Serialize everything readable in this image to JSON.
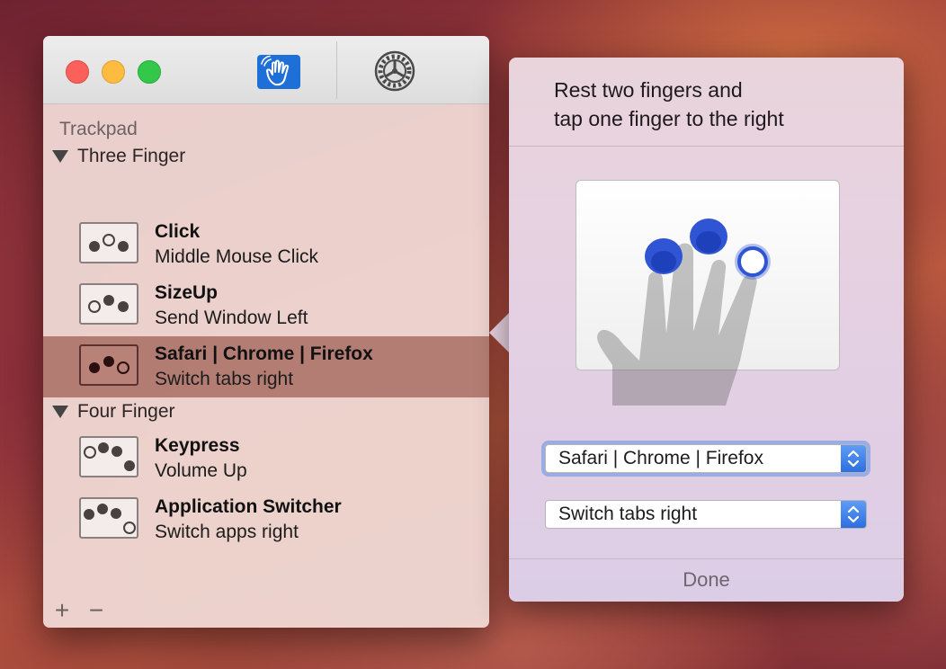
{
  "window": {
    "toolbar": {
      "gesture_tab_icon": "hand-gesture-icon",
      "settings_tab_icon": "gear-icon"
    },
    "section_title": "Trackpad",
    "groups": [
      {
        "label": "Three Finger",
        "rows": [
          {
            "title": "Click",
            "subtitle": "Middle Mouse Click",
            "icon": "three-finger-middle-tap-icon"
          },
          {
            "title": "SizeUp",
            "subtitle": "Send Window Left",
            "icon": "three-finger-left-tap-icon"
          },
          {
            "title": "Safari | Chrome | Firefox",
            "subtitle": "Switch tabs right",
            "icon": "three-finger-right-tap-icon",
            "selected": true
          }
        ]
      },
      {
        "label": "Four Finger",
        "rows": [
          {
            "title": "Keypress",
            "subtitle": "Volume Up",
            "icon": "four-finger-left-tap-icon"
          },
          {
            "title": "Application Switcher",
            "subtitle": "Switch apps right",
            "icon": "four-finger-right-tap-icon"
          }
        ]
      }
    ],
    "add_label": "+",
    "remove_label": "−"
  },
  "popover": {
    "instruction_line1": "Rest two fingers and",
    "instruction_line2": "tap one finger to the right",
    "app_select_value": "Safari | Chrome | Firefox",
    "action_select_value": "Switch tabs right",
    "done_label": "Done"
  },
  "colors": {
    "accent": "#1f6fd9",
    "selected_row": "#a06056",
    "finger_blue": "#2f55d4"
  }
}
